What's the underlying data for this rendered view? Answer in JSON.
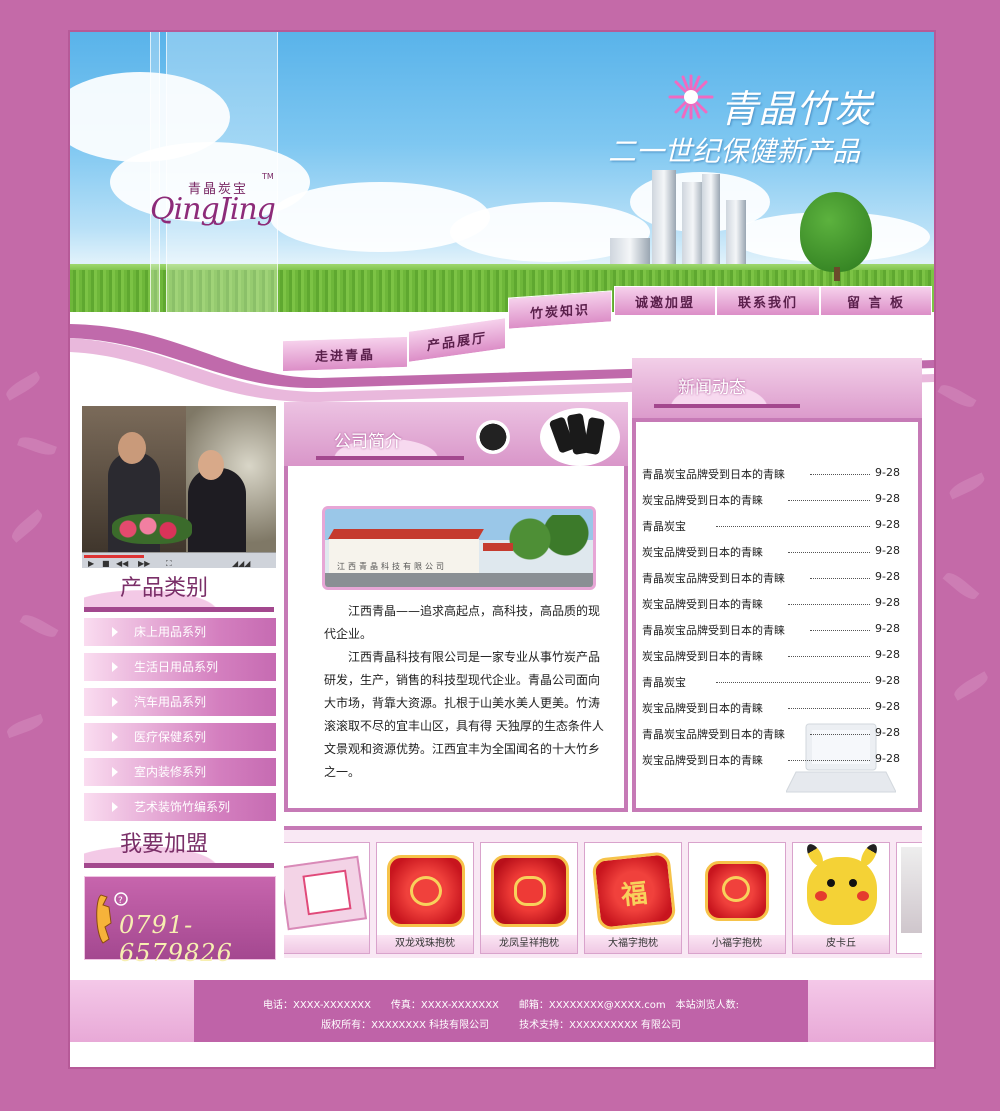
{
  "banner": {
    "logo_cn": "青晶炭宝",
    "logo_en": "QingJing",
    "logo_tm": "TM",
    "slogan_main": "青晶竹炭",
    "slogan_sub": "二一世纪保健新产品"
  },
  "nav": {
    "items": [
      {
        "label": "走进青晶"
      },
      {
        "label": "产品展厅"
      },
      {
        "label": "竹炭知识"
      },
      {
        "label": "诚邀加盟"
      },
      {
        "label": "联系我们"
      },
      {
        "label": "留 言 板"
      }
    ]
  },
  "sidebar": {
    "category_title": "产品类别",
    "categories": [
      {
        "label": "床上用品系列"
      },
      {
        "label": "生活日用品系列"
      },
      {
        "label": "汽车用品系列"
      },
      {
        "label": "医疗保健系列"
      },
      {
        "label": "室内装修系列"
      },
      {
        "label": "艺术装饰竹编系列"
      }
    ],
    "join_title": "我要加盟",
    "phone": "0791-6579826"
  },
  "company": {
    "title": "公司简介",
    "factory_sign": "江西青晶科技有限公司",
    "paragraphs": [
      "江西青晶——追求高起点，高科技，高品质的现代企业。",
      "江西青晶科技有限公司是一家专业从事竹炭产品研发，生产，销售的科技型现代企业。青晶公司面向大市场，背靠大资源。扎根于山美水美人更美。竹涛滚滚取不尽的宜丰山区，具有得 天独厚的生态条件人文景观和资源优势。江西宜丰为全国闻名的十大竹乡之一。"
    ]
  },
  "news": {
    "title": "新闻动态",
    "items": [
      {
        "text": "青晶炭宝品牌受到日本的青睐",
        "date": "9-28"
      },
      {
        "text": "炭宝品牌受到日本的青睐",
        "date": "9-28"
      },
      {
        "text": "青晶炭宝",
        "date": "9-28"
      },
      {
        "text": "炭宝品牌受到日本的青睐",
        "date": "9-28"
      },
      {
        "text": "青晶炭宝品牌受到日本的青睐",
        "date": "9-28"
      },
      {
        "text": "炭宝品牌受到日本的青睐",
        "date": "9-28"
      },
      {
        "text": "青晶炭宝品牌受到日本的青睐",
        "date": "9-28"
      },
      {
        "text": "炭宝品牌受到日本的青睐",
        "date": "9-28"
      },
      {
        "text": "青晶炭宝",
        "date": "9-28"
      },
      {
        "text": "炭宝品牌受到日本的青睐",
        "date": "9-28"
      },
      {
        "text": "青晶炭宝品牌受到日本的青睐",
        "date": "9-28"
      },
      {
        "text": "炭宝品牌受到日本的青睐",
        "date": "9-28"
      }
    ]
  },
  "products": [
    {
      "caption": "",
      "icon": "gift-box"
    },
    {
      "caption": "双龙戏珠抱枕",
      "icon": "pillow-dragon"
    },
    {
      "caption": "龙凤呈祥抱枕",
      "icon": "pillow-phoenix"
    },
    {
      "caption": "大福字抱枕",
      "icon": "pillow-fu"
    },
    {
      "caption": "小福字抱枕",
      "icon": "pillow-small-fu"
    },
    {
      "caption": "皮卡丘",
      "icon": "pikachu"
    }
  ],
  "footer": {
    "line1": "电话：XXXX-XXXXXXX　　传真：XXXX-XXXXXXX　　邮箱：XXXXXXXX@XXXX.com　本站浏览人数:",
    "line2": "版权所有：XXXXXXXX 科技有限公司　　　技术支持：XXXXXXXXXX 有限公司"
  },
  "colors": {
    "background": "#c46aa8",
    "accent": "#a3488e",
    "nav_tab": "#dc8ec7"
  }
}
